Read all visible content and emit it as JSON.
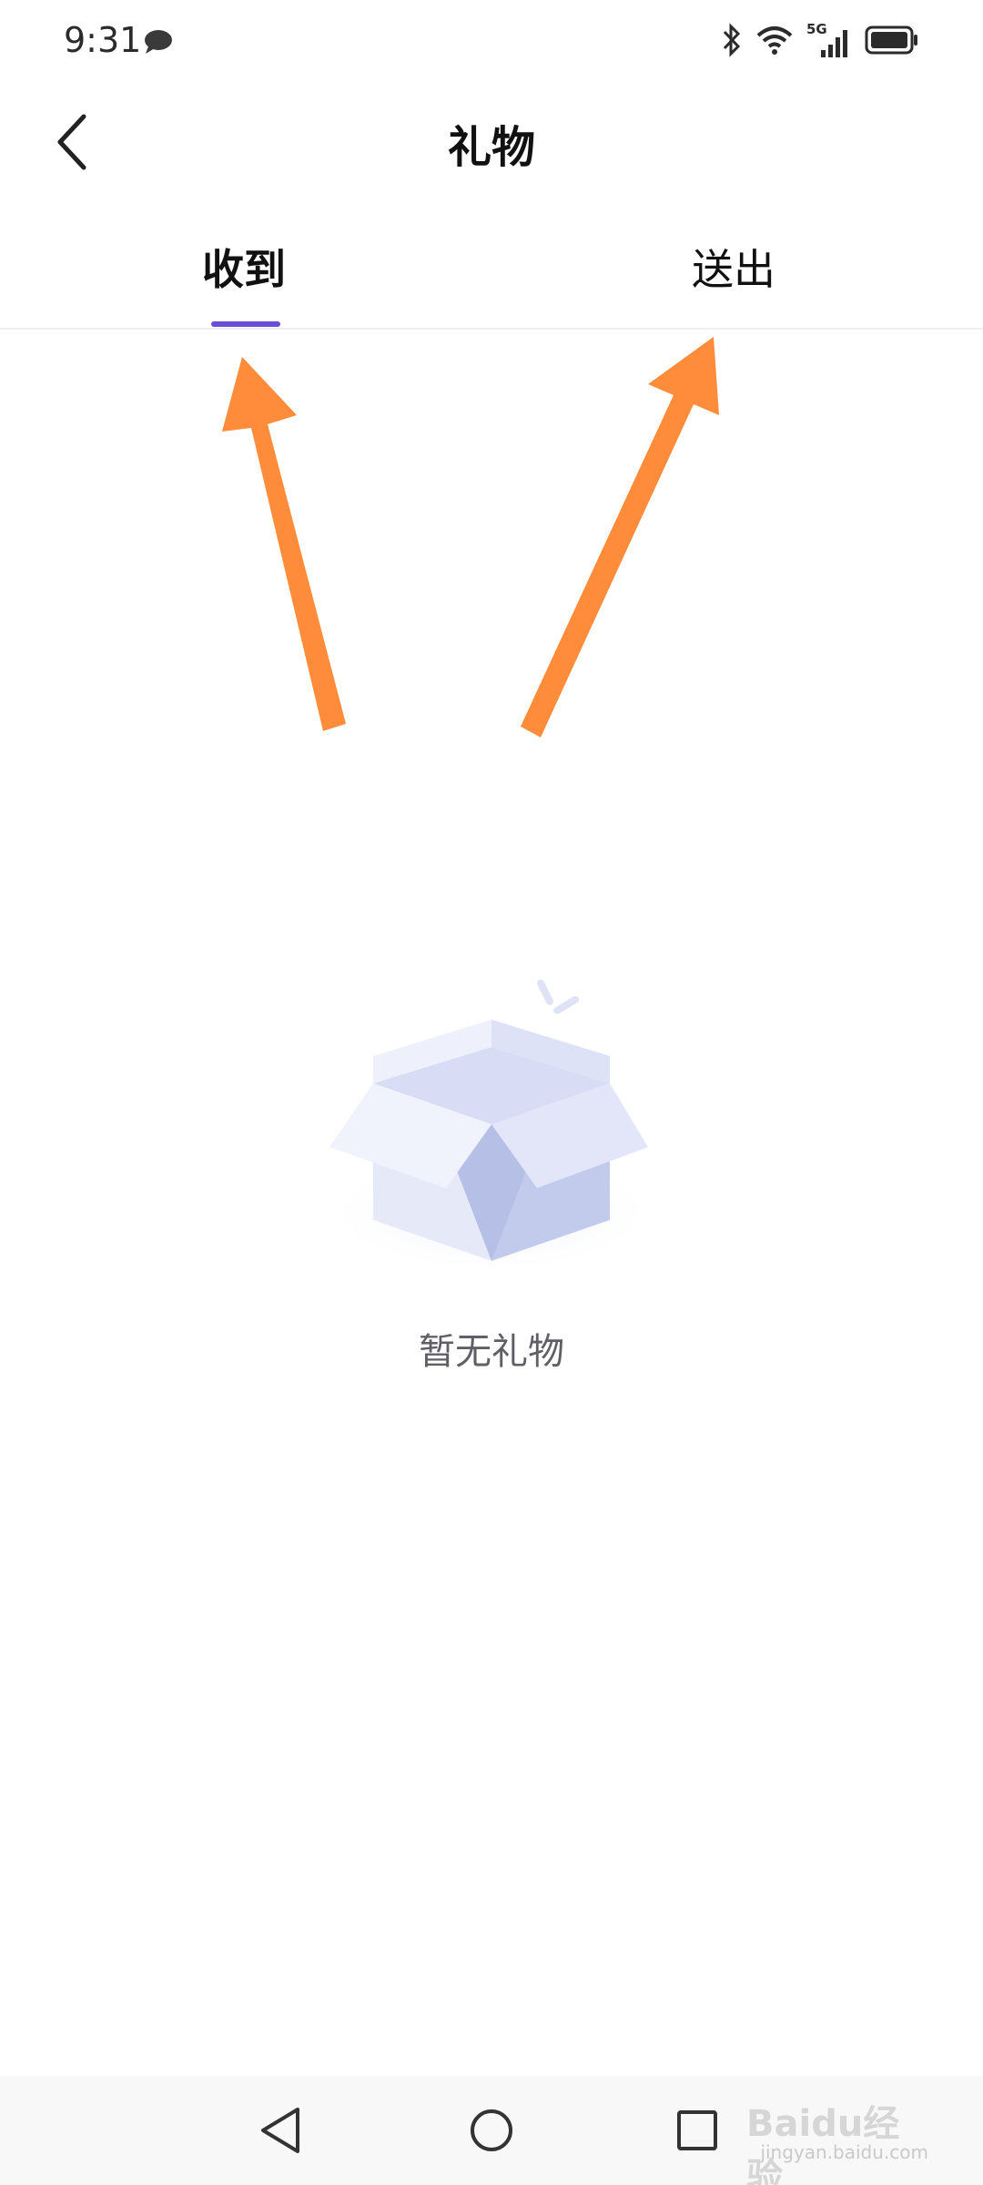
{
  "status_bar": {
    "time": "9:31",
    "network": "5G",
    "icons": [
      "chat-bubble-icon",
      "bluetooth-icon",
      "wifi-icon",
      "signal-icon",
      "battery-icon"
    ]
  },
  "header": {
    "title": "礼物",
    "back_icon": "chevron-left-icon"
  },
  "tabs": [
    {
      "label": "收到",
      "active": true
    },
    {
      "label": "送出",
      "active": false
    }
  ],
  "empty_state": {
    "icon": "open-box-icon",
    "message": "暂无礼物"
  },
  "nav_bar": {
    "icons": [
      "triangle-back-icon",
      "circle-home-icon",
      "square-recents-icon"
    ]
  },
  "watermark": {
    "brand": "Baidu经验",
    "url": "jingyan.baidu.com"
  },
  "colors": {
    "accent": "#6a4fd6",
    "annotation_arrow": "#ff8c3a",
    "empty_text": "#5f5f66",
    "box_light": "#e8ebfa",
    "box_dark": "#b9c2e6"
  }
}
